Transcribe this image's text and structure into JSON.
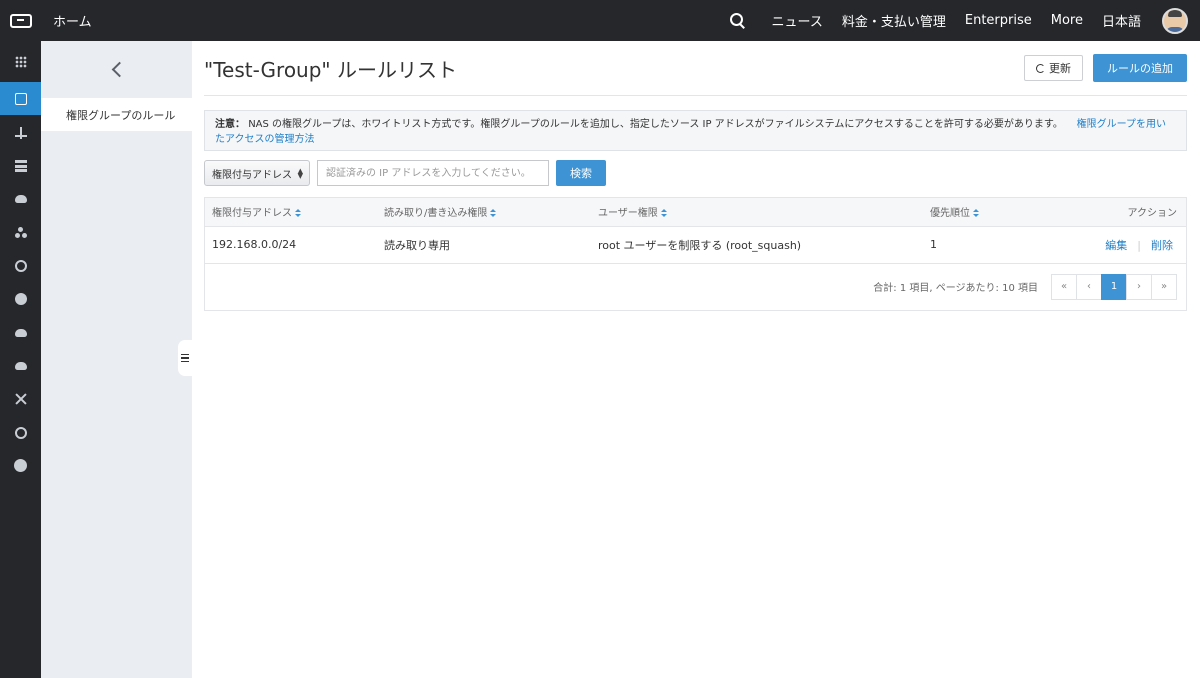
{
  "topbar": {
    "home": "ホーム",
    "nav": [
      "ニュース",
      "料金・支払い管理",
      "Enterprise",
      "More",
      "日本語"
    ]
  },
  "rail": {
    "icons": [
      "apps-grid-icon",
      "nas-storage-icon",
      "network-icon",
      "database-icon",
      "megaphone-icon",
      "cluster-icon",
      "monitor-search-icon",
      "security-shield-icon",
      "cloud-sync-icon",
      "cloud-upload-icon",
      "share-icon",
      "bug-icon",
      "circle-icon"
    ],
    "active_index": 1
  },
  "subsidebar": {
    "items": [
      "権限グループのルール"
    ]
  },
  "main": {
    "title": "\"Test-Group\" ルールリスト",
    "refresh_label": "更新",
    "add_label": "ルールの追加",
    "notice": {
      "prefix": "注意：",
      "text": "NAS の権限グループは、ホワイトリスト方式です。権限グループのルールを追加し、指定したソース IP アドレスがファイルシステムにアクセスすることを許可する必要があります。",
      "link_part1": "権限グループを用い",
      "link_part2": "たアクセスの管理方法"
    },
    "search": {
      "select_value": "権限付与アドレス",
      "placeholder": "認証済みの IP アドレスを入力してください。",
      "button": "検索"
    },
    "table": {
      "headers": [
        "権限付与アドレス",
        "読み取り/書き込み権限",
        "ユーザー権限",
        "優先順位",
        "アクション"
      ],
      "rows": [
        {
          "address": "192.168.0.0/24",
          "rw": "読み取り専用",
          "user": "root ユーザーを制限する (root_squash)",
          "priority": "1",
          "edit": "編集",
          "delete": "削除"
        }
      ]
    },
    "pagination": {
      "summary": "合計: 1 項目, ページあたり: 10 項目",
      "first": "«",
      "prev": "‹",
      "current": "1",
      "next": "›",
      "last": "»"
    }
  },
  "colors": {
    "topbar": "#25272b",
    "accent": "#3d93d3",
    "link": "#1f7fc8",
    "subsidebar": "#eaedf1"
  }
}
